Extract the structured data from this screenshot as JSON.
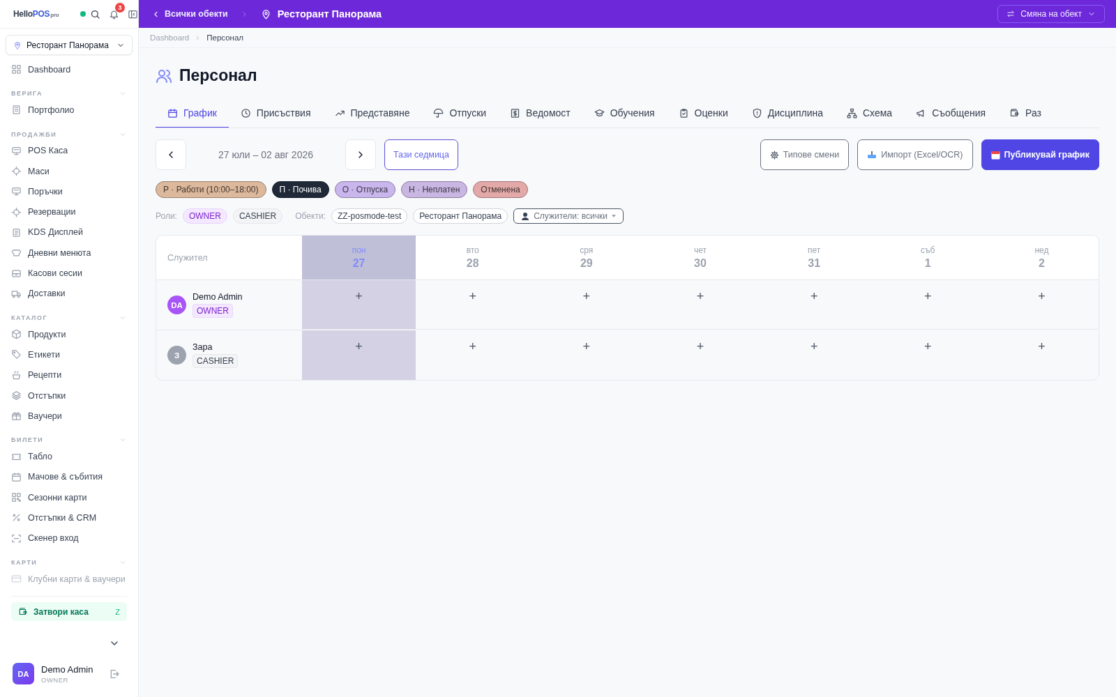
{
  "sidebar": {
    "logo": {
      "first": "Hello",
      "second": "POS",
      "suffix": "pro"
    },
    "online": true,
    "notifications": "3",
    "location": "Ресторант Панорама",
    "sections": [
      {
        "items": [
          {
            "label": "Dashboard",
            "disabled": false
          }
        ]
      },
      {
        "title": "ВЕРИГА",
        "expanded": true,
        "items": [
          {
            "label": "Портфолио",
            "disabled": false
          }
        ]
      },
      {
        "title": "ПРОДАЖБИ",
        "expanded": true,
        "items": [
          {
            "label": "POS Каса",
            "disabled": false
          },
          {
            "label": "Маси",
            "disabled": false
          },
          {
            "label": "Поръчки",
            "disabled": false
          },
          {
            "label": "Резервации",
            "disabled": false
          },
          {
            "label": "KDS Дисплей",
            "disabled": false
          },
          {
            "label": "Дневни менюта",
            "disabled": false
          },
          {
            "label": "Касови сесии",
            "disabled": false
          },
          {
            "label": "Доставки",
            "disabled": false
          }
        ]
      },
      {
        "title": "КАТАЛОГ",
        "expanded": true,
        "items": [
          {
            "label": "Продукти",
            "disabled": false
          },
          {
            "label": "Етикети",
            "disabled": false
          },
          {
            "label": "Рецепти",
            "disabled": false
          },
          {
            "label": "Отстъпки",
            "disabled": false
          },
          {
            "label": "Ваучери",
            "disabled": false
          }
        ]
      },
      {
        "title": "БИЛЕТИ",
        "expanded": true,
        "items": [
          {
            "label": "Табло",
            "disabled": false
          },
          {
            "label": "Мачове & събития",
            "disabled": false
          },
          {
            "label": "Сезонни карти",
            "disabled": false
          },
          {
            "label": "Отстъпки & CRM",
            "disabled": false
          },
          {
            "label": "Скенер вход",
            "disabled": false
          }
        ]
      },
      {
        "title": "КАРТИ",
        "expanded": true,
        "items": [
          {
            "label": "Клубни карти & ваучери",
            "disabled": true
          }
        ]
      }
    ],
    "close_register": {
      "label": "Затвори каса",
      "shortcut": "Z"
    },
    "user": {
      "initials": "DA",
      "name": "Demo Admin",
      "role": "OWNER"
    }
  },
  "topbar": {
    "back": "Всички обекти",
    "location": "Ресторант Панорама",
    "switch": "Смяна на обект"
  },
  "breadcrumbs": [
    "Dashboard",
    "Персонал"
  ],
  "title": "Персонал",
  "tabs": [
    {
      "label": "График",
      "selected": true
    },
    {
      "label": "Присъствия",
      "selected": false
    },
    {
      "label": "Представяне",
      "selected": false
    },
    {
      "label": "Отпуски",
      "selected": false
    },
    {
      "label": "Ведомост",
      "selected": false
    },
    {
      "label": "Обучения",
      "selected": false
    },
    {
      "label": "Оценки",
      "selected": false
    },
    {
      "label": "Дисциплина",
      "selected": false
    },
    {
      "label": "Схема",
      "selected": false
    },
    {
      "label": "Съобщения",
      "selected": false
    },
    {
      "label": "Раз",
      "selected": false
    }
  ],
  "week": {
    "range": "27 юли – 02 авг 2026",
    "today_button": "Тази седмица"
  },
  "actions": [
    {
      "kind": "gear",
      "label": "Типове смени"
    },
    {
      "kind": "import",
      "label": "Импорт (Excel/OCR)"
    },
    {
      "kind": "publish",
      "label": "Публикувай график"
    }
  ],
  "legend": [
    {
      "label": "Р · Работи (10:00–18:00)",
      "color": "#dcb89c"
    },
    {
      "label": "П · Почива",
      "color": "#1f2937"
    },
    {
      "label": "О · Отпуска",
      "color": "#c8b6ec"
    },
    {
      "label": "Н · Неплатен",
      "color": "#c9b6e2"
    },
    {
      "label": "Отменена",
      "color": "#e3a9a9"
    }
  ],
  "filters": {
    "roles_label": "Роли:",
    "roles": [
      {
        "label": "OWNER",
        "selected": true
      },
      {
        "label": "CASHIER",
        "selected": false
      }
    ],
    "sites_label": "Обекти:",
    "sites": [
      "ZZ-posmode-test",
      "Ресторант Панорама"
    ],
    "employees": "Служители: всички"
  },
  "schedule": {
    "employee_header": "Служител",
    "days": [
      {
        "dow": "пон",
        "date": "27",
        "selected": true
      },
      {
        "dow": "вто",
        "date": "28",
        "selected": false
      },
      {
        "dow": "сря",
        "date": "29",
        "selected": false
      },
      {
        "dow": "чет",
        "date": "30",
        "selected": false
      },
      {
        "dow": "пет",
        "date": "31",
        "selected": false
      },
      {
        "dow": "съб",
        "date": "1",
        "selected": false
      },
      {
        "dow": "нед",
        "date": "2",
        "selected": false
      }
    ],
    "rows": [
      {
        "initials": "DA",
        "name": "Demo Admin",
        "role": "OWNER",
        "color": "#a855f7",
        "cells": [
          "+",
          "+",
          "+",
          "+",
          "+",
          "+",
          "+"
        ]
      },
      {
        "initials": "З",
        "name": "Зара",
        "role": "CASHIER",
        "color": "#9ca3af",
        "cells": [
          "+",
          "+",
          "+",
          "+",
          "+",
          "+",
          "+"
        ]
      }
    ]
  }
}
